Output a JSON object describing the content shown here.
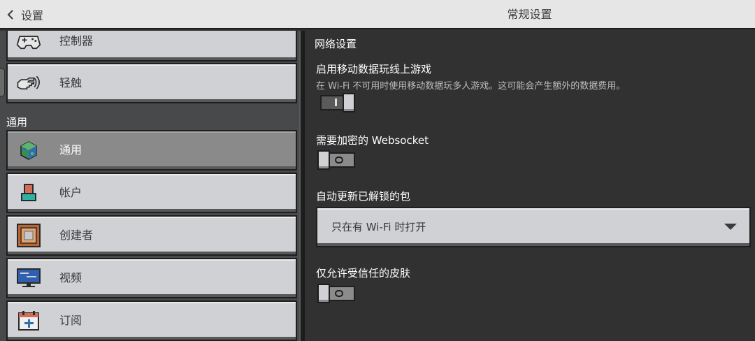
{
  "header": {
    "back_label": "设置",
    "title": "常规设置"
  },
  "sidebar": {
    "items": [
      {
        "label": "控制器",
        "icon": "gamepad-icon"
      },
      {
        "label": "轻触",
        "icon": "touch-hand-icon"
      }
    ],
    "section_label": "通用",
    "general_items": [
      {
        "label": "通用",
        "icon": "globe-cube-icon",
        "selected": true
      },
      {
        "label": "帐户",
        "icon": "account-icon"
      },
      {
        "label": "创建者",
        "icon": "command-block-icon"
      },
      {
        "label": "视频",
        "icon": "monitor-icon"
      },
      {
        "label": "订阅",
        "icon": "calendar-plus-icon"
      }
    ]
  },
  "content": {
    "section_heading": "网络设置",
    "mobile_data": {
      "title": "启用移动数据玩线上游戏",
      "description": "在 Wi-Fi 不可用时使用移动数据玩多人游戏。这可能会产生额外的数据费用。",
      "enabled": true
    },
    "encrypted_websocket": {
      "title": "需要加密的 Websocket",
      "enabled": false
    },
    "auto_update": {
      "title": "自动更新已解锁的包",
      "selected_option": "只在有 Wi-Fi 时打开"
    },
    "trusted_skins": {
      "title": "仅允许受信任的皮肤",
      "enabled": false
    }
  },
  "colors": {
    "topbar": "#e6e6e6",
    "panel_bg": "#313131",
    "sidebar_bg": "#48494a",
    "button_bg": "#d0d1d4",
    "button_selected": "#8a8a8a"
  }
}
